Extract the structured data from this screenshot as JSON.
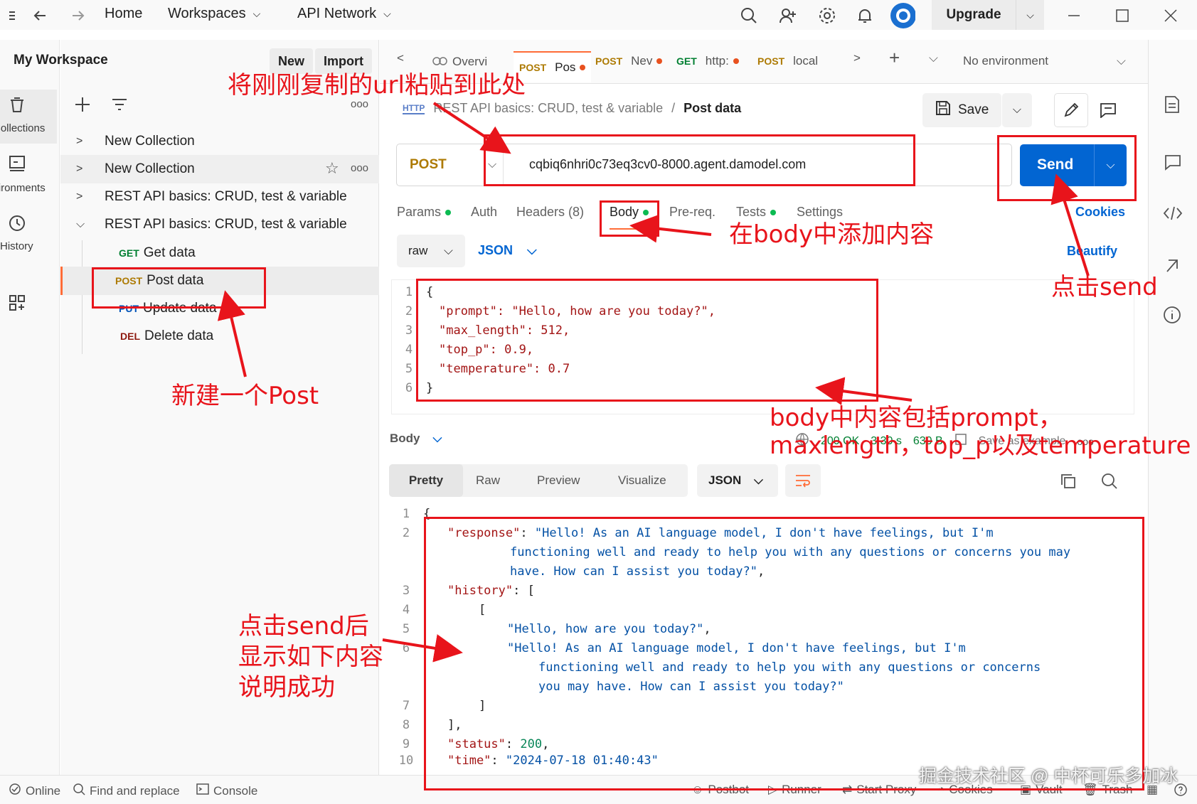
{
  "titlebar": {
    "menu_home": "Home",
    "menu_workspaces": "Workspaces",
    "menu_api_network": "API Network",
    "upgrade": "Upgrade"
  },
  "rail": {
    "collections": "Collections",
    "environments": "Environments",
    "history": "History"
  },
  "sidebar": {
    "workspace_title": "My Workspace",
    "new_btn": "New",
    "import_btn": "Import",
    "items": [
      {
        "label": "New Collection"
      },
      {
        "label": "New Collection"
      },
      {
        "label": "REST API basics: CRUD, test & variable"
      },
      {
        "label": "REST API basics: CRUD, test & variable"
      }
    ],
    "requests": [
      {
        "method": "GET",
        "label": "Get data"
      },
      {
        "method": "POST",
        "label": "Post data"
      },
      {
        "method": "PUT",
        "label": "Update data"
      },
      {
        "method": "DEL",
        "label": "Delete data"
      }
    ]
  },
  "tabs": [
    {
      "method": "",
      "label": "Overvi"
    },
    {
      "method": "POST",
      "label": "Pos"
    },
    {
      "method": "POST",
      "label": "Nev"
    },
    {
      "method": "GET",
      "label": "http:"
    },
    {
      "method": "POST",
      "label": "local"
    }
  ],
  "environment": "No environment",
  "breadcrumb": {
    "collection": "REST API basics: CRUD, test & variable",
    "current": "Post data"
  },
  "save_label": "Save",
  "request": {
    "method": "POST",
    "url": "cqbiq6nhri0c73eq3cv0-8000.agent.damodel.com",
    "send": "Send",
    "cookies": "Cookies",
    "beautify": "Beautify",
    "tabs": {
      "params": "Params",
      "auth": "Auth",
      "headers": "Headers (8)",
      "body": "Body",
      "prereq": "Pre-req.",
      "tests": "Tests",
      "settings": "Settings"
    },
    "body_mode": "raw",
    "body_lang": "JSON",
    "body_lines": [
      "{",
      "\"prompt\": \"Hello, how are you today?\",",
      "\"max_length\": 512,",
      "\"top_p\": 0.9,",
      "\"temperature\": 0.7",
      "}"
    ]
  },
  "response": {
    "label": "Body",
    "status": "200 OK",
    "time": "3.30 s",
    "size": "630 B",
    "save_example": "Save as example",
    "view_tabs": [
      "Pretty",
      "Raw",
      "Preview",
      "Visualize"
    ],
    "lang": "JSON",
    "line_numbers": [
      "1",
      "2",
      "3",
      "4",
      "5",
      "6",
      "7",
      "8",
      "9",
      "10"
    ]
  },
  "statusbar": {
    "online": "Online",
    "find_replace": "Find and replace",
    "console": "Console",
    "postbot": "Postbot",
    "runner": "Runner",
    "start_proxy": "Start Proxy",
    "cookies": "Cookies",
    "vault": "Vault",
    "trash": "Trash"
  },
  "annotations": {
    "paste_url": "将刚刚复制的url粘贴到此处",
    "add_body": "在body中添加内容",
    "click_send": "点击send",
    "new_post": "新建一个Post",
    "body_contents_1": "body中内容包括prompt，",
    "body_contents_2": "maxlength，top_p以及temperature",
    "success_1": "点击send后",
    "success_2": "显示如下内容",
    "success_3": "说明成功"
  },
  "watermark": "掘金技术社区 @ 中杯可乐多加冰",
  "colors": {
    "send_blue": "#0265d2",
    "annotation_red": "#e8141b",
    "post_method": "#ad7a03",
    "get_method": "#007f31",
    "put_method": "#0053b8",
    "del_method": "#8e1a10"
  }
}
